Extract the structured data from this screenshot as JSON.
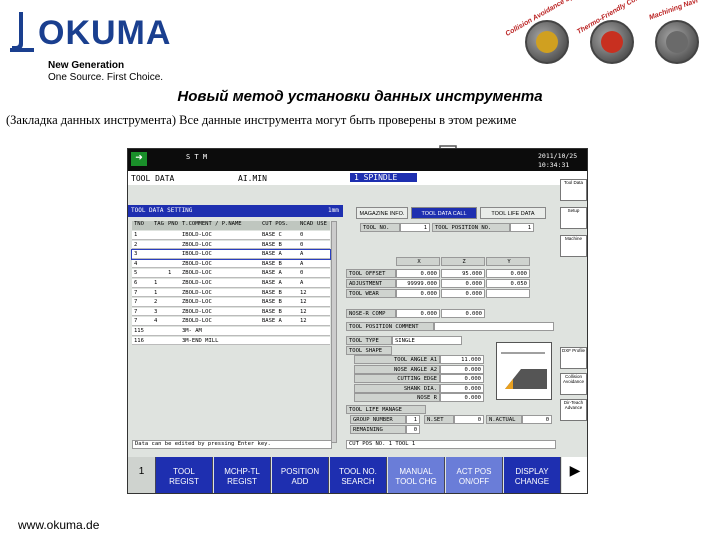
{
  "brand": {
    "wordmark": "OKUMA",
    "tagline_1": "New Generation",
    "tagline_2": "One Source. First Choice."
  },
  "slide": {
    "title": "Новый метод установки данных инструмента",
    "subtitle": "(Закладка данных инструмента)  Все данные инструмента могут быть проверены в этом режиме",
    "footer": "www.okuma.de"
  },
  "badges": [
    {
      "label": "Collision Avoidance System",
      "color": "#d0a020"
    },
    {
      "label": "Thermo-Friendly Concept",
      "color": "#c83020"
    },
    {
      "label": "Machining Navi",
      "color": "#6a6a6a"
    }
  ],
  "screen": {
    "topbar": {
      "mode": "S T M",
      "date": "2011/10/25",
      "time": "10:34:31"
    },
    "title": "TOOL DATA",
    "mode": "AI.MIN",
    "spindle": "1 SPINDLE",
    "section": "TOOL DATA SETTING",
    "section_unit": "1mm",
    "columns": [
      "TNO",
      "TAG",
      "PNO",
      "T.COMMENT / P.NAME",
      "CUT POS.",
      "NCAD",
      "USE"
    ],
    "rows": [
      {
        "tno": "1",
        "tag": "",
        "pno": "",
        "name": "IBOLD-LOC",
        "pos": "BASE  C",
        "ncad": "0",
        "use": ""
      },
      {
        "tno": "2",
        "tag": "",
        "pno": "",
        "name": "ZBOLD-LOC",
        "pos": "BASE  B",
        "ncad": "0",
        "use": ""
      },
      {
        "tno": "3",
        "tag": "",
        "pno": "",
        "name": "IBOLD-LOC",
        "pos": "BASE  A",
        "ncad": "A",
        "use": ""
      },
      {
        "tno": "4",
        "tag": "",
        "pno": "",
        "name": "ZBOLD-LOC",
        "pos": "BASE  B",
        "ncad": "A",
        "use": ""
      },
      {
        "tno": "5",
        "tag": "",
        "pno": "1",
        "name": "ZBOLD-LOC",
        "pos": "BASE  A",
        "ncad": "0",
        "use": ""
      },
      {
        "tno": "6",
        "tag": "1",
        "pno": "",
        "name": "ZBOLD-LOC",
        "pos": "BASE  A",
        "ncad": "A",
        "use": ""
      },
      {
        "tno": "7",
        "tag": "1",
        "pno": "",
        "name": "ZBOLD-LOC",
        "pos": "BASE  B",
        "ncad": "12",
        "use": ""
      },
      {
        "tno": "7",
        "tag": "2",
        "pno": "",
        "name": "ZBOLD-LOC",
        "pos": "BASE  B",
        "ncad": "12",
        "use": ""
      },
      {
        "tno": "7",
        "tag": "3",
        "pno": "",
        "name": "ZBOLD-LOC",
        "pos": "BASE  B",
        "ncad": "12",
        "use": ""
      },
      {
        "tno": "7",
        "tag": "4",
        "pno": "",
        "name": "ZBOLD-LOC",
        "pos": "BASE  A",
        "ncad": "12",
        "use": ""
      },
      {
        "tno": "115",
        "tag": "",
        "pno": "",
        "name": "3M- AM",
        "pos": "",
        "ncad": "",
        "use": ""
      },
      {
        "tno": "116",
        "tag": "",
        "pno": "",
        "name": "3M-END MILL",
        "pos": "",
        "ncad": "",
        "use": ""
      }
    ],
    "status_msg": "Data can be edited by pressing Enter key.",
    "tabs": [
      "MAGAZINE INFO.",
      "TOOL DATA CALL",
      "TOOL LIFE DATA"
    ],
    "tool_no_label": "TOOL NO.",
    "tool_no": "1",
    "tool_pos_label": "TOOL POSITION NO.",
    "tool_pos": "1",
    "offset_cols": [
      "X",
      "Z",
      "Y"
    ],
    "offset_rows": [
      {
        "label": "TOOL OFFSET",
        "x": "0.000",
        "z": "95.000",
        "y": "0.000"
      },
      {
        "label": "ADJUSTMENT",
        "x": "99999.000",
        "z": "0.000",
        "y": "0.050"
      },
      {
        "label": "TOOL WEAR",
        "x": "0.000",
        "z": "0.000",
        "y": ""
      }
    ],
    "nose_label": "NOSE-R COMP",
    "nose_x": "0.000",
    "nose_z": "0.000",
    "comment_label": "TOOL POSITION COMMENT",
    "tool_type_label": "TOOL TYPE",
    "tool_type": "SINGLE",
    "tool_shape_label": "TOOL SHAPE",
    "shape_rows": [
      {
        "label": "TOOL ANGLE A1",
        "val": "11.000"
      },
      {
        "label": "NOSE ANGLE A2",
        "val": "0.000"
      },
      {
        "label": "CUTTING EDGE",
        "val": "0.000"
      },
      {
        "label": "SHANK DIA.",
        "val": "0.000"
      },
      {
        "label": "NOSE R",
        "val": "0.000"
      }
    ],
    "life_label": "TOOL LIFE MANAGE",
    "group_label": "GROUP NUMBER",
    "group_val": "1",
    "nset_label": "N.SET",
    "nset_val": "0",
    "nact_label": "N.ACTUAL",
    "nact_val": "0",
    "remain_label": "REMAINING",
    "remain_val": "0",
    "status_line": "CUT  POS  NO.  1   TOOL  1",
    "side_buttons": [
      "Tool Data",
      "Setup",
      "Machine",
      "DXF Profile",
      "Collision Avoidance",
      "Dir-Teach Advance"
    ],
    "fkeys": [
      {
        "l1": "TOOL",
        "l2": "REGIST"
      },
      {
        "l1": "MCHP-TL",
        "l2": "REGIST"
      },
      {
        "l1": "POSITION",
        "l2": "ADD"
      },
      {
        "l1": "TOOL NO.",
        "l2": "SEARCH"
      },
      {
        "l1": "MANUAL",
        "l2": "TOOL CHG"
      },
      {
        "l1": "ACT POS",
        "l2": "ON/OFF"
      },
      {
        "l1": "DISPLAY",
        "l2": "CHANGE"
      }
    ],
    "fkey_page": "1"
  }
}
